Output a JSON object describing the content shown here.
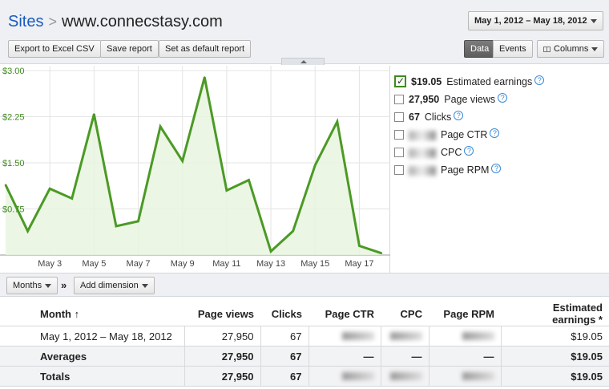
{
  "header": {
    "breadcrumb_root": "Sites",
    "breadcrumb_sep": ">",
    "site": "www.connecstasy.com",
    "date_range": "May 1, 2012 – May 18, 2012",
    "export_label": "Export to Excel CSV",
    "save_label": "Save report",
    "default_label": "Set as default report",
    "data_label": "Data",
    "events_label": "Events",
    "columns_label": "Columns",
    "columns_icon": "grid-icon"
  },
  "chart_data": {
    "type": "area",
    "series": [
      {
        "name": "Estimated earnings",
        "color": "#4b9a25",
        "values": [
          1.14,
          0.39,
          1.08,
          0.92,
          2.29,
          0.47,
          0.55,
          2.09,
          1.53,
          2.89,
          1.05,
          1.22,
          0.06,
          0.39,
          1.46,
          2.17,
          0.15,
          0.03
        ]
      }
    ],
    "x": [
      "May 1",
      "May 2",
      "May 3",
      "May 4",
      "May 5",
      "May 6",
      "May 7",
      "May 8",
      "May 9",
      "May 10",
      "May 11",
      "May 12",
      "May 13",
      "May 14",
      "May 15",
      "May 16",
      "May 17",
      "May 18"
    ],
    "x_ticks": [
      "May 3",
      "May 5",
      "May 7",
      "May 9",
      "May 11",
      "May 13",
      "May 15",
      "May 17"
    ],
    "y_ticks": [
      "$3.00",
      "$2.25",
      "$1.50",
      "$0.75"
    ],
    "ylim": [
      0,
      3.0
    ],
    "grid": true,
    "tick_color": "#3f8a1f"
  },
  "metrics": [
    {
      "value": "$19.05",
      "label": "Estimated earnings",
      "checked": true
    },
    {
      "value": "27,950",
      "label": "Page views",
      "checked": false
    },
    {
      "value": "67",
      "label": "Clicks",
      "checked": false
    },
    {
      "value": "",
      "label": "Page CTR",
      "checked": false
    },
    {
      "value": "",
      "label": "CPC",
      "checked": false
    },
    {
      "value": "",
      "label": "Page RPM",
      "checked": false
    }
  ],
  "dimension": {
    "months_label": "Months",
    "separator": "»",
    "add_label": "Add dimension"
  },
  "table": {
    "columns": [
      "Month ↑",
      "Page views",
      "Clicks",
      "Page CTR",
      "CPC",
      "Page RPM",
      "Estimated earnings *"
    ],
    "rows": [
      {
        "month": "May 1, 2012 – May 18, 2012",
        "page_views": "27,950",
        "clicks": "67",
        "ctr": "",
        "cpc": "",
        "rpm": "",
        "earnings": "$19.05"
      },
      {
        "month": "Averages",
        "page_views": "27,950",
        "clicks": "67",
        "ctr": "—",
        "cpc": "—",
        "rpm": "—",
        "earnings": "$19.05"
      },
      {
        "month": "Totals",
        "page_views": "27,950",
        "clicks": "67",
        "ctr": "",
        "cpc": "",
        "rpm": "",
        "earnings": "$19.05"
      }
    ]
  }
}
